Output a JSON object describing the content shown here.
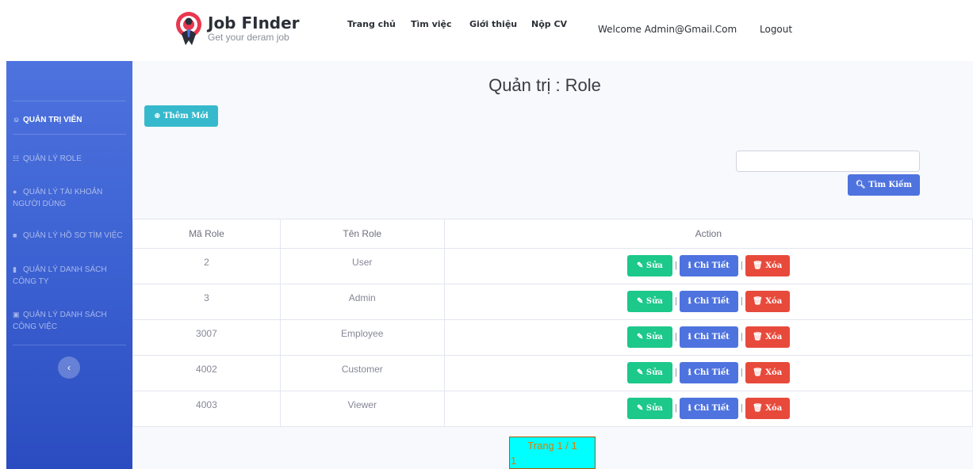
{
  "brand": {
    "name": "Job FInder",
    "tagline": "Get your deram job"
  },
  "nav": {
    "items": [
      "Trang chủ",
      "Tìm việc",
      "Giới thiệu",
      "Nộp CV"
    ],
    "welcome": "Welcome Admin@Gmail.Com",
    "logout": "Logout"
  },
  "sidebar": {
    "header": "QUẢN TRỊ VIÊN",
    "items": [
      {
        "label": "QUẢN LÝ ROLE",
        "icon": "sitemap-icon"
      },
      {
        "label": "QUẢN LÝ TÀI KHOẢN NGƯỜI DÙNG",
        "icon": "user-icon"
      },
      {
        "label": "QUẢN LÝ HỒ SƠ TÌM VIỆC",
        "icon": "folder-icon"
      },
      {
        "label": "QUẢN LÝ DANH SÁCH CÔNG TY",
        "icon": "building-icon"
      },
      {
        "label": "QUẢN LÝ DANH SÁCH CÔNG VIỆC",
        "icon": "briefcase-icon"
      }
    ],
    "toggle": "‹"
  },
  "page": {
    "title": "Quản trị : Role",
    "add_button": "Thêm Mới",
    "search_placeholder": "",
    "search_button": "Tìm Kiếm"
  },
  "table": {
    "headers": [
      "Mã Role",
      "Tên Role",
      "Action"
    ],
    "rows": [
      {
        "id": "2",
        "name": "User"
      },
      {
        "id": "3",
        "name": "Admin"
      },
      {
        "id": "3007",
        "name": "Employee"
      },
      {
        "id": "4002",
        "name": "Customer"
      },
      {
        "id": "4003",
        "name": "Viewer"
      }
    ],
    "actions": {
      "edit": "Sửa",
      "detail": "Chi Tiết",
      "delete": "Xóa",
      "separator": "|"
    }
  },
  "pagination": {
    "text": "Trang 1 / 1",
    "page": "1"
  },
  "colors": {
    "sidebar": "#4e73df",
    "add": "#36b9cc",
    "edit": "#1cc88a",
    "detail": "#4e73df",
    "delete": "#e74a3b",
    "pager": "#00ffff"
  }
}
